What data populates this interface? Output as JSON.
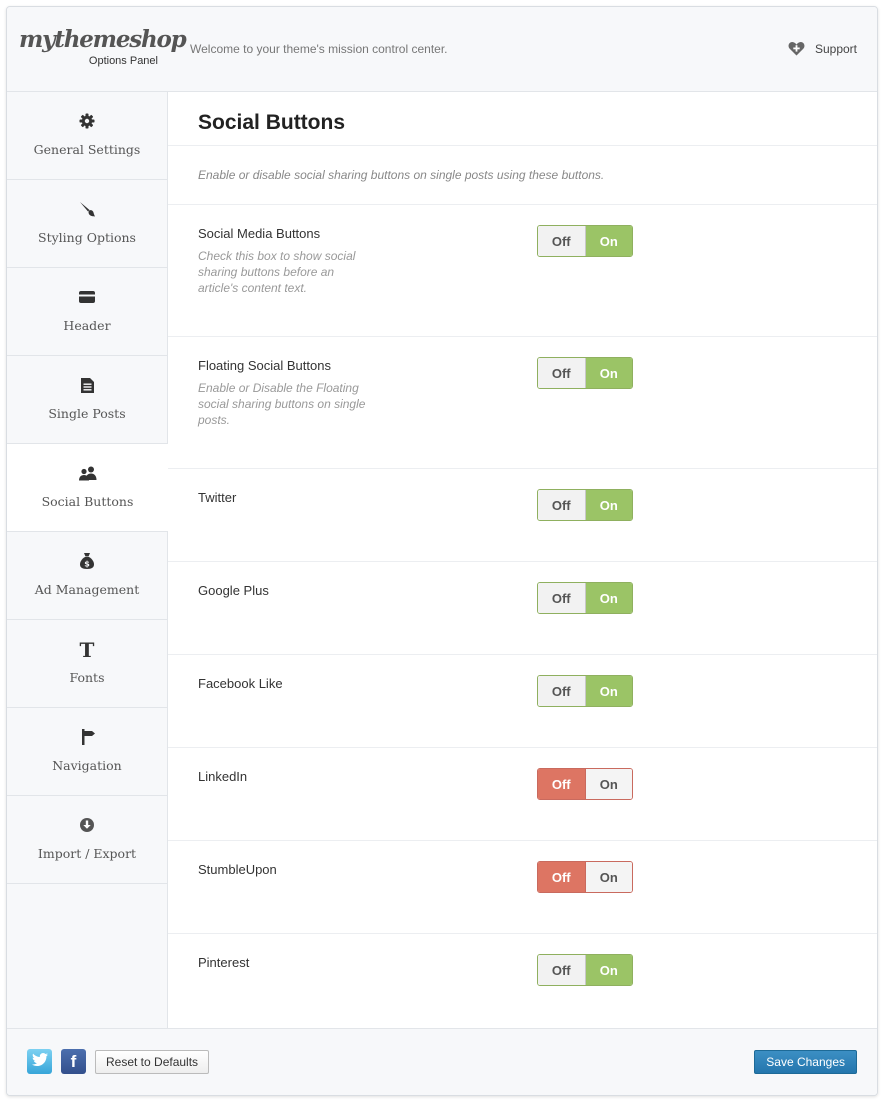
{
  "header": {
    "logo_text": "mythemeshop",
    "logo_sub": "Options Panel",
    "welcome": "Welcome to your theme's mission control center.",
    "support_label": "Support",
    "support_icon": "heart-plus-icon"
  },
  "sidebar": {
    "items": [
      {
        "label": "General Settings",
        "icon": "gear-icon"
      },
      {
        "label": "Styling Options",
        "icon": "brush-icon"
      },
      {
        "label": "Header",
        "icon": "card-icon"
      },
      {
        "label": "Single Posts",
        "icon": "document-icon"
      },
      {
        "label": "Social Buttons",
        "icon": "users-icon",
        "active": true
      },
      {
        "label": "Ad Management",
        "icon": "money-bag-icon"
      },
      {
        "label": "Fonts",
        "icon": "font-t-icon"
      },
      {
        "label": "Navigation",
        "icon": "signpost-icon"
      },
      {
        "label": "Import / Export",
        "icon": "download-circle-icon"
      }
    ]
  },
  "content": {
    "title": "Social Buttons",
    "description": "Enable or disable social sharing buttons on single posts using these buttons.",
    "options": [
      {
        "title": "Social Media Buttons",
        "desc": "Check this box to show social sharing buttons before an article's content text.",
        "state": "on",
        "off_label": "Off",
        "on_label": "On"
      },
      {
        "title": "Floating Social Buttons",
        "desc": "Enable or Disable the Floating social sharing buttons on single posts.",
        "state": "on",
        "off_label": "Off",
        "on_label": "On"
      },
      {
        "title": "Twitter",
        "state": "on",
        "off_label": "Off",
        "on_label": "On"
      },
      {
        "title": "Google Plus",
        "state": "on",
        "off_label": "Off",
        "on_label": "On"
      },
      {
        "title": "Facebook Like",
        "state": "on",
        "off_label": "Off",
        "on_label": "On"
      },
      {
        "title": "LinkedIn",
        "state": "off",
        "off_label": "Off",
        "on_label": "On"
      },
      {
        "title": "StumbleUpon",
        "state": "off",
        "off_label": "Off",
        "on_label": "On"
      },
      {
        "title": "Pinterest",
        "state": "on",
        "off_label": "Off",
        "on_label": "On"
      }
    ]
  },
  "footer": {
    "twitter_icon": "twitter-bird-icon",
    "facebook_icon": "facebook-f-icon",
    "facebook_glyph": "f",
    "reset_label": "Reset to Defaults",
    "save_label": "Save Changes"
  },
  "colors": {
    "toggle_on": "#9bc466",
    "toggle_off": "#dd7563",
    "save_button": "#2a7db3"
  }
}
